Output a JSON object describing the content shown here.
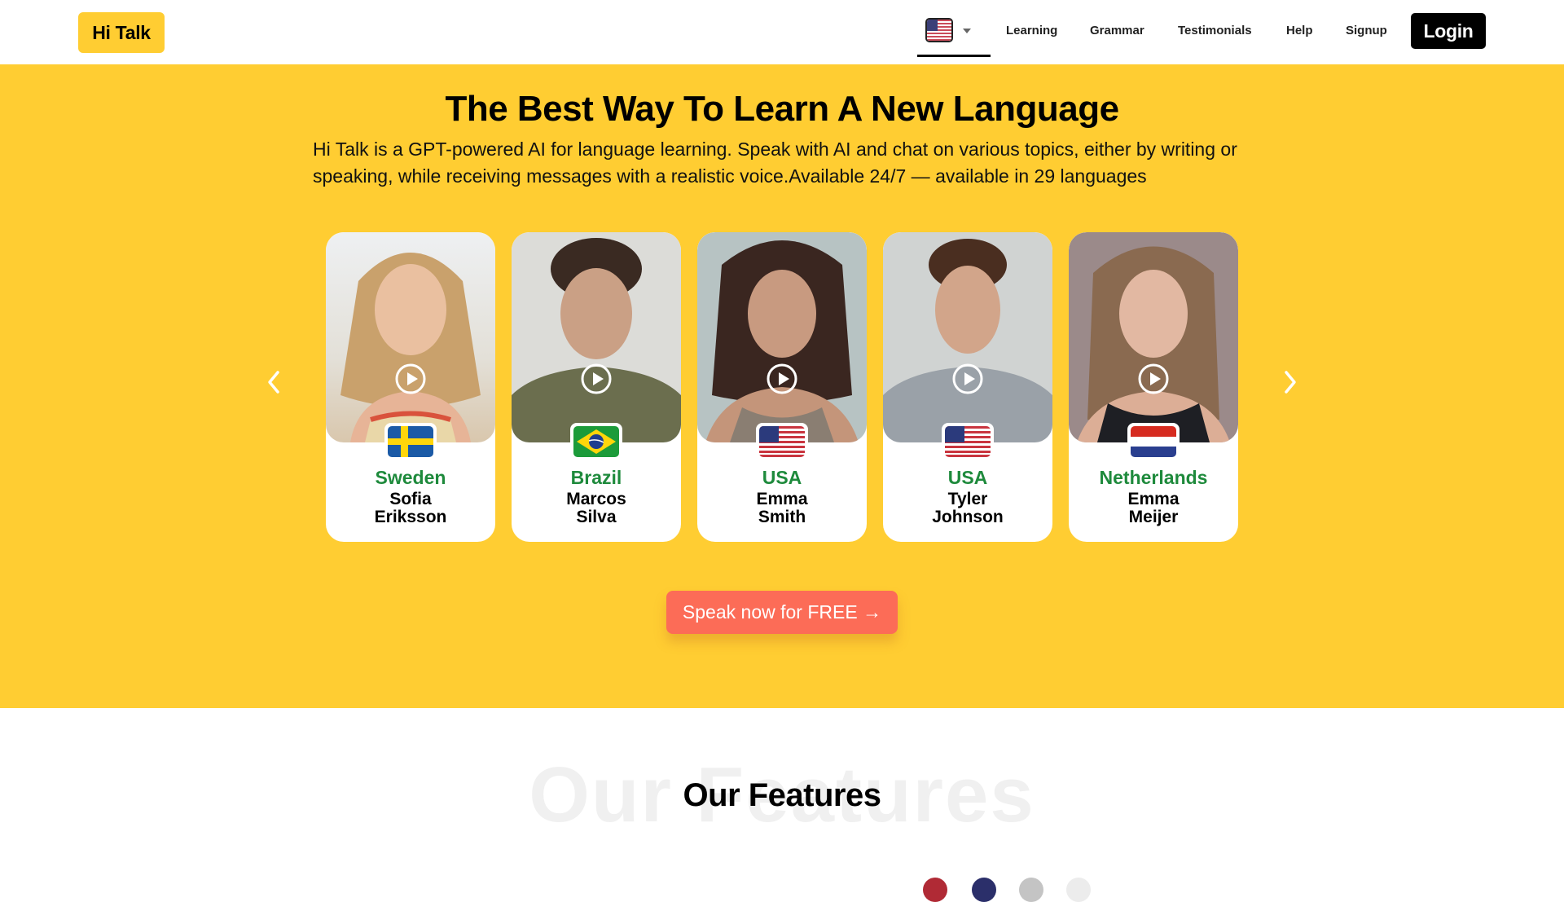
{
  "header": {
    "logo": "Hi Talk",
    "language_selector": {
      "selected_flag": "usa-flag-icon"
    },
    "nav": [
      {
        "label": "Learning"
      },
      {
        "label": "Grammar"
      },
      {
        "label": "Testimonials"
      },
      {
        "label": "Help"
      },
      {
        "label": "Signup"
      }
    ],
    "login_label": "Login"
  },
  "hero": {
    "title": "The Best Way To Learn A New Language",
    "description": "Hi Talk is a GPT-powered AI for language learning. Speak with AI and chat on various topics, either by writing or speaking, while receiving messages with a realistic voice.Available 24/7 — available in 29 languages",
    "cards": [
      {
        "country": "Sweden",
        "first_name": "Sofia",
        "last_name": "Eriksson",
        "flag": "sweden-flag-icon"
      },
      {
        "country": "Brazil",
        "first_name": "Marcos",
        "last_name": "Silva",
        "flag": "brazil-flag-icon"
      },
      {
        "country": "USA",
        "first_name": "Emma",
        "last_name": "Smith",
        "flag": "usa-flag-icon"
      },
      {
        "country": "USA",
        "first_name": "Tyler",
        "last_name": "Johnson",
        "flag": "usa-flag-icon"
      },
      {
        "country": "Netherlands",
        "first_name": "Emma",
        "last_name": "Meijer",
        "flag": "netherlands-flag-icon"
      }
    ],
    "cta_label": "Speak now for FREE →"
  },
  "features": {
    "background_text": "Our Features",
    "title": "Our Features"
  },
  "colors": {
    "brand_yellow": "#ffcd32",
    "cta_coral": "#fc6c57",
    "country_green": "#1e8a3c"
  }
}
